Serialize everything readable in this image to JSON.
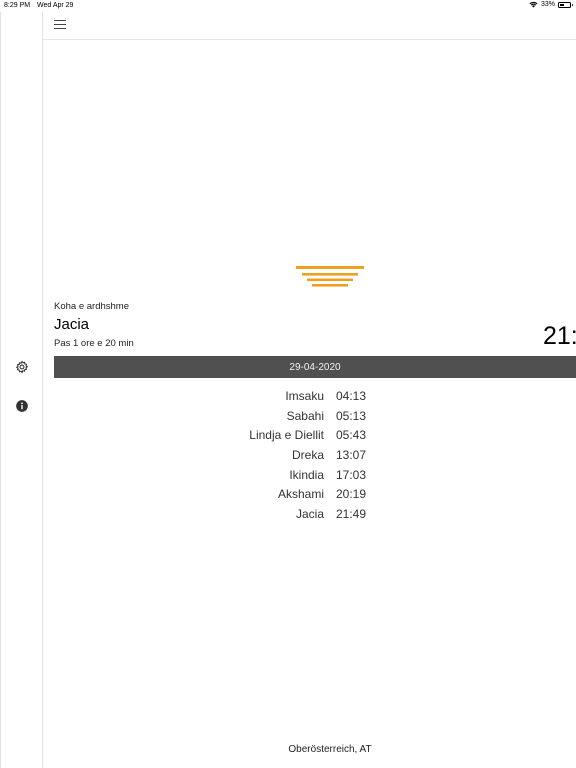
{
  "status_bar": {
    "time": "8:29 PM",
    "date": "Wed Apr 29",
    "battery_text": "33%",
    "battery_level": 0.33
  },
  "sidebar": {
    "icons": [
      "gear-icon",
      "info-icon"
    ]
  },
  "header": {
    "menu_icon": "hamburger-menu-icon"
  },
  "next_prayer": {
    "label": "Koha e ardhshme",
    "name": "Jacia",
    "remaining": "Pas 1 ore e 20 min",
    "clock": "21:"
  },
  "date_bar": {
    "date": "29-04-2020"
  },
  "prayers": [
    {
      "name": "Imsaku",
      "time": "04:13"
    },
    {
      "name": "Sabahi",
      "time": "05:13"
    },
    {
      "name": "Lindja e Diellit",
      "time": "05:43"
    },
    {
      "name": "Dreka",
      "time": "13:07"
    },
    {
      "name": "Ikindia",
      "time": "17:03"
    },
    {
      "name": "Akshami",
      "time": "20:19"
    },
    {
      "name": "Jacia",
      "time": "21:49"
    }
  ],
  "footer": {
    "location": "Oberösterreich, AT"
  },
  "colors": {
    "moon": "#e8b955",
    "horizon": "#f0a020",
    "date_bar_bg": "#505050"
  }
}
